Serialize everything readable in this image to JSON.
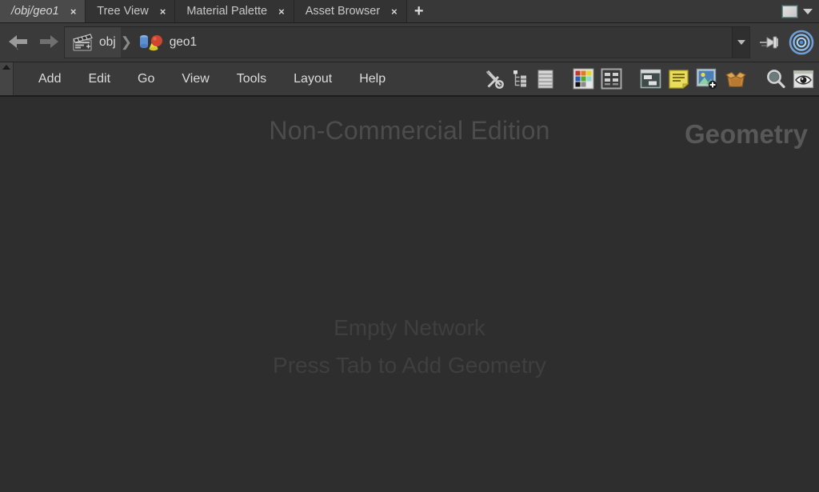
{
  "window": {
    "pane_icon_name": "pane-layout-icon",
    "menu_arrow_name": "pane-menu-chevron"
  },
  "tabs": {
    "items": [
      {
        "label": "/obj/geo1",
        "active": true,
        "close": "×"
      },
      {
        "label": "Tree View",
        "active": false,
        "close": "×"
      },
      {
        "label": "Material Palette",
        "active": false,
        "close": "×"
      },
      {
        "label": "Asset Browser",
        "active": false,
        "close": "×"
      }
    ],
    "add_label": "+"
  },
  "pathbar": {
    "back_tooltip": "Back",
    "forward_tooltip": "Forward",
    "crumbs": [
      {
        "label": "obj",
        "icon": "clapperboard-icon"
      },
      {
        "label": "geo1",
        "icon": "geometry-primitives-icon"
      }
    ],
    "separator": "❯",
    "dropdown_label": "▼",
    "pin_icon": "pin-icon",
    "target_icon": "target-rings-icon"
  },
  "menubar": {
    "collapse_label": "▲",
    "items": [
      {
        "label": "Add"
      },
      {
        "label": "Edit"
      },
      {
        "label": "Go"
      },
      {
        "label": "View"
      },
      {
        "label": "Tools"
      },
      {
        "label": "Layout"
      },
      {
        "label": "Help"
      }
    ],
    "toolbar_groups": [
      {
        "icons": [
          {
            "name": "tools-wrench-screwdriver-icon"
          },
          {
            "name": "tree-hierarchy-icon"
          },
          {
            "name": "spreadsheet-list-icon"
          }
        ]
      },
      {
        "icons": [
          {
            "name": "color-palette-grid-icon"
          },
          {
            "name": "layout-grid-icon"
          }
        ]
      },
      {
        "icons": [
          {
            "name": "panel-window-icon"
          },
          {
            "name": "sticky-note-icon"
          },
          {
            "name": "add-image-icon"
          },
          {
            "name": "asset-box-icon"
          }
        ]
      },
      {
        "icons": [
          {
            "name": "search-magnifier-icon"
          },
          {
            "name": "visibility-eye-icon"
          }
        ]
      }
    ]
  },
  "network": {
    "watermark_edition": "Non-Commercial Edition",
    "watermark_context": "Geometry",
    "empty_title": "Empty Network",
    "empty_hint": "Press Tab to Add Geometry"
  },
  "colors": {
    "canvas_bg": "#2e2e2e",
    "chrome_bg": "#3a3a3a",
    "tab_active_bg": "#4a4a4a",
    "text_primary": "#dcdcdc",
    "watermark": "#4c4c4c",
    "accent_blue": "#4a90d9",
    "swatch_red": "#c0392b",
    "swatch_orange": "#e07b20",
    "swatch_yellow": "#e8d52a",
    "swatch_blue": "#2a5bb8",
    "swatch_green": "#5aa82a",
    "swatch_cyan": "#8fd9d0",
    "swatch_black": "#111111",
    "swatch_gray": "#8a8a8a",
    "swatch_white": "#e8e8e8"
  }
}
